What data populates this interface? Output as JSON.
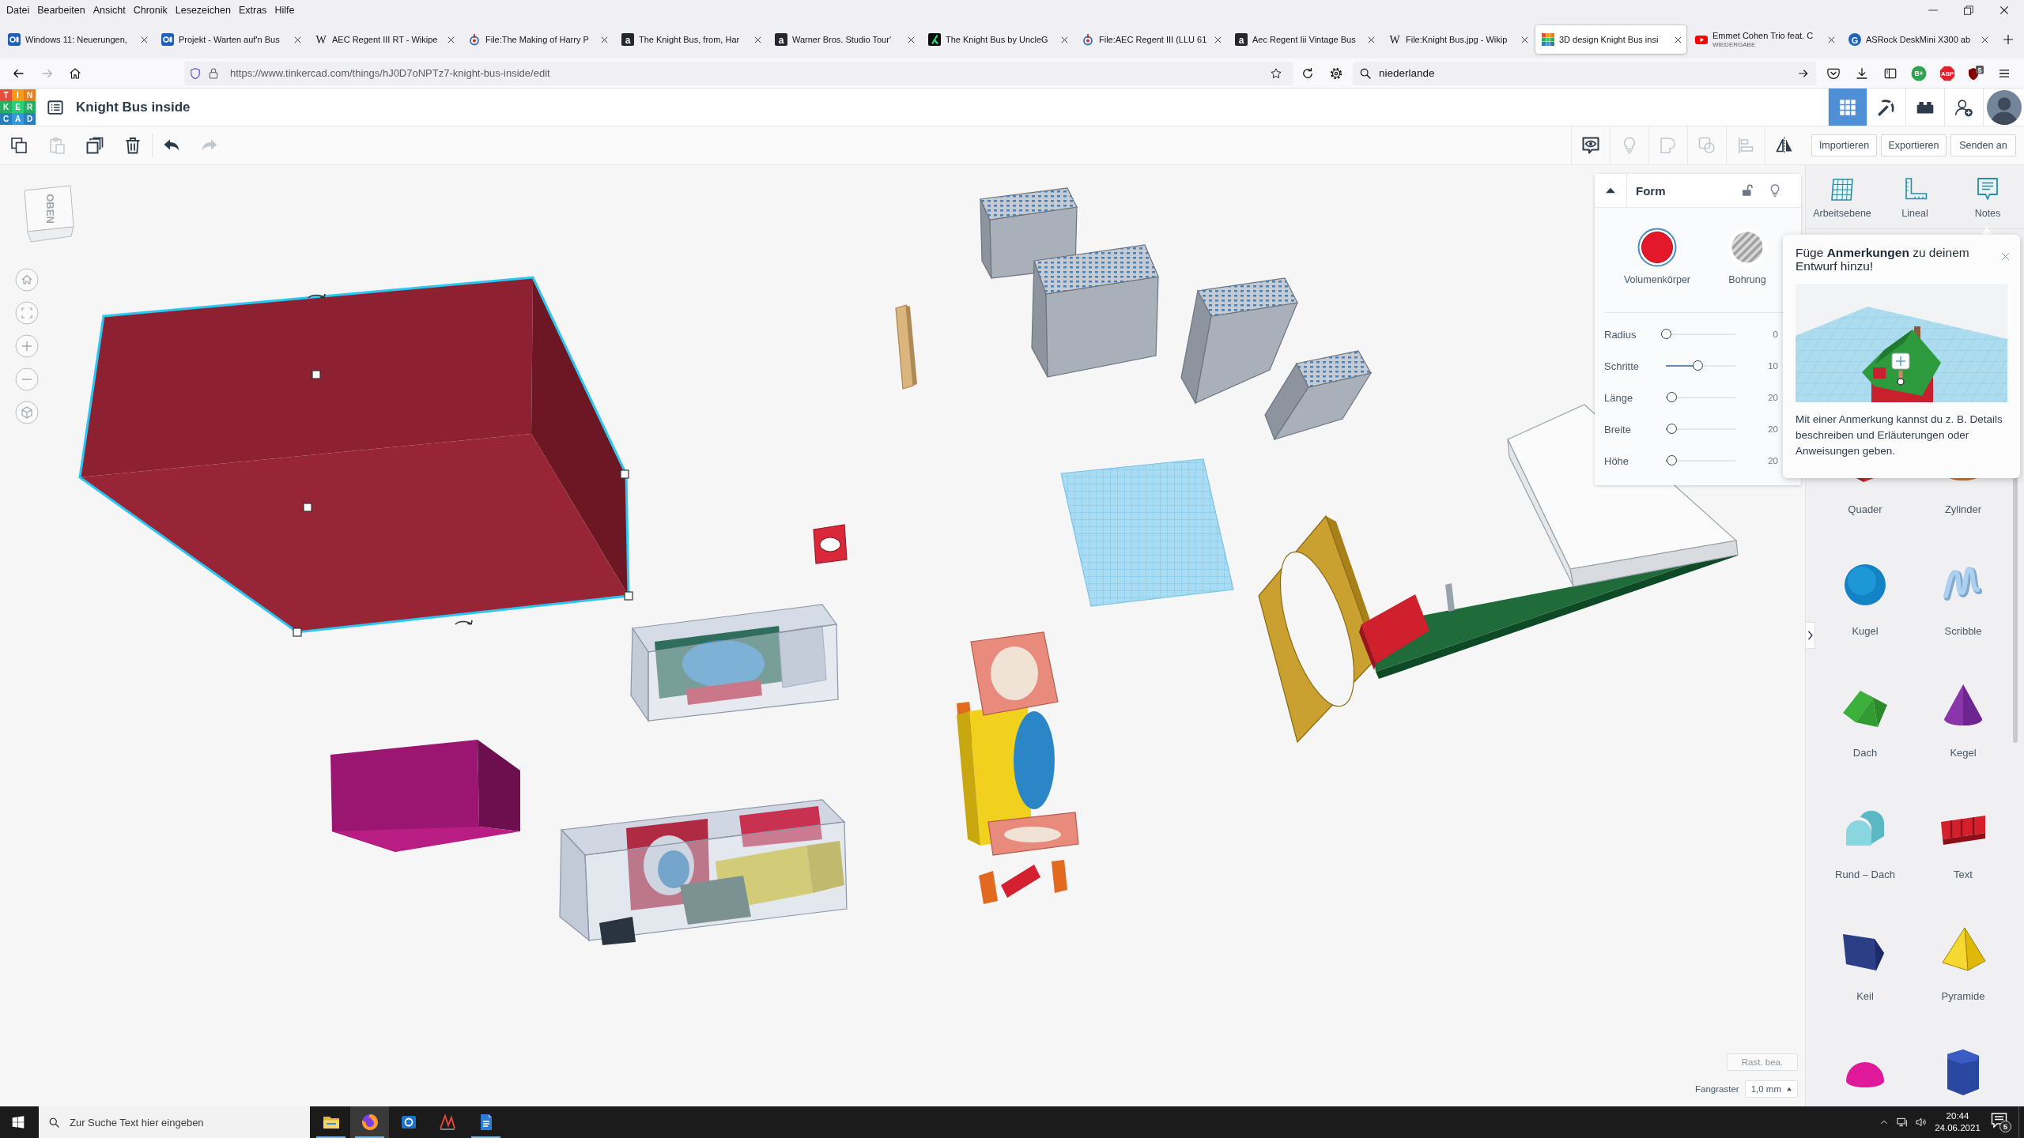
{
  "browser": {
    "menu": [
      "Datei",
      "Bearbeiten",
      "Ansicht",
      "Chronik",
      "Lesezeichen",
      "Extras",
      "Hilfe"
    ],
    "tabs": [
      {
        "title": "Windows 11: Neuerungen,",
        "kind": "cb",
        "selected": false
      },
      {
        "title": "Projekt - Warten auf'n Bus",
        "kind": "cb",
        "selected": false
      },
      {
        "title": "AEC Regent III RT - Wikipe",
        "kind": "wiki",
        "glyph": "W",
        "selected": false
      },
      {
        "title": "File:The Making of Harry P",
        "kind": "commons",
        "selected": false
      },
      {
        "title": "The Knight Bus, from, Har",
        "kind": "a",
        "glyph": "a",
        "selected": false
      },
      {
        "title": "Warner Bros. Studio Tour'",
        "kind": "a",
        "glyph": "a",
        "selected": false
      },
      {
        "title": "The Knight Bus by UncleG",
        "kind": "k",
        "selected": false
      },
      {
        "title": "File:AEC Regent III (LLU 61",
        "kind": "commons",
        "selected": false
      },
      {
        "title": "Aec Regent Iii Vintage Bus",
        "kind": "a",
        "glyph": "a",
        "selected": false
      },
      {
        "title": "File:Knight Bus.jpg - Wikip",
        "kind": "wiki",
        "glyph": "W",
        "selected": false
      },
      {
        "title": "3D design Knight Bus insi",
        "kind": "tinkercad",
        "selected": true
      },
      {
        "title": "Emmet Cohen Trio feat. C",
        "subtitle": "WIEDERGABE",
        "kind": "youtube",
        "selected": false
      },
      {
        "title": "ASRock DeskMini X300 ab",
        "kind": "g",
        "glyph": "G",
        "selected": false
      }
    ],
    "url": "https://www.tinkercad.com/things/hJ0D7oNPTz7-knight-bus-inside/edit",
    "search": {
      "value": "niederlande"
    },
    "extensions": [
      {
        "kind": "bplus",
        "label": "B+"
      },
      {
        "kind": "abp",
        "label": "ABP"
      },
      {
        "kind": "ublock",
        "badge": "5"
      }
    ]
  },
  "app": {
    "logo": [
      [
        "T",
        "I",
        "N"
      ],
      [
        "K",
        "E",
        "R"
      ],
      [
        "C",
        "A",
        "D"
      ]
    ],
    "title": "Knight Bus inside",
    "views": [
      {
        "kind": "grid",
        "selected": true
      },
      {
        "kind": "pickaxe",
        "selected": false
      },
      {
        "kind": "bricks",
        "selected": false
      }
    ],
    "edit_tools": [
      {
        "kind": "copy",
        "disabled": false
      },
      {
        "kind": "paste",
        "disabled": true
      },
      {
        "kind": "duplicate",
        "disabled": false
      },
      {
        "kind": "delete",
        "disabled": false
      }
    ],
    "history_tools": [
      {
        "kind": "undo",
        "disabled": false
      },
      {
        "kind": "redo",
        "disabled": true
      }
    ],
    "shape_tools": [
      {
        "kind": "notes",
        "disabled": false
      },
      {
        "kind": "bulb",
        "disabled": true
      },
      {
        "kind": "group",
        "disabled": true
      },
      {
        "kind": "ungroup",
        "disabled": true
      },
      {
        "kind": "align",
        "disabled": true
      },
      {
        "kind": "mirror",
        "disabled": false
      }
    ],
    "actions": [
      "Importieren",
      "Exportieren",
      "Senden an"
    ]
  },
  "viewcube": {
    "label": "OBEN"
  },
  "view_controls": [
    {
      "kind": "home"
    },
    {
      "kind": "fit"
    },
    {
      "kind": "zoom-in"
    },
    {
      "kind": "zoom-out"
    },
    {
      "kind": "ortho"
    }
  ],
  "scene": {
    "objects": [
      {
        "kind": "box",
        "selected": true
      },
      {
        "kind": "stick",
        "selected": false
      },
      {
        "kind": "stamps",
        "selected": false
      },
      {
        "kind": "plate",
        "selected": false
      },
      {
        "kind": "tile",
        "selected": false
      },
      {
        "kind": "case",
        "selected": false
      },
      {
        "kind": "block",
        "selected": false
      },
      {
        "kind": "crate",
        "selected": false
      },
      {
        "kind": "figure",
        "selected": false
      },
      {
        "kind": "frame",
        "selected": false
      },
      {
        "kind": "deck",
        "selected": false
      },
      {
        "kind": "slab",
        "selected": false
      }
    ]
  },
  "inspector": {
    "title": "Form",
    "options": [
      {
        "label": "Volumenkörper",
        "kind": "solid",
        "selected": true
      },
      {
        "label": "Bohrung",
        "kind": "hole",
        "selected": false
      }
    ],
    "sliders": [
      {
        "label": "Radius",
        "level": 0,
        "value": "0"
      },
      {
        "label": "Schritte",
        "level": 0.46,
        "value": "10"
      },
      {
        "label": "Länge",
        "level": 0.09,
        "value": "20"
      },
      {
        "label": "Breite",
        "level": 0.09,
        "value": "20"
      },
      {
        "label": "Höhe",
        "level": 0.09,
        "value": "20"
      }
    ]
  },
  "tools": [
    {
      "label": "Arbeitsebene",
      "kind": "workplane"
    },
    {
      "label": "Lineal",
      "kind": "ruler"
    },
    {
      "label": "Notes",
      "kind": "notes"
    }
  ],
  "notes_tip": {
    "title": "Füge **Anmerkungen** zu deinem Entwurf hinzu!",
    "body": "Mit einer Anmerkung kannst du z. B. Details beschreiben und Erläuterungen oder Anweisungen geben."
  },
  "shapes": [
    {
      "label": "Quader",
      "kind": "box"
    },
    {
      "label": "Zylinder",
      "kind": "cylinder"
    },
    {
      "label": "Kugel",
      "kind": "sphere"
    },
    {
      "label": "Scribble",
      "kind": "scribble"
    },
    {
      "label": "Dach",
      "kind": "roof"
    },
    {
      "label": "Kegel",
      "kind": "cone"
    },
    {
      "label": "Rund – Dach",
      "kind": "round-roof"
    },
    {
      "label": "Text",
      "kind": "text"
    },
    {
      "label": "Keil",
      "kind": "wedge"
    },
    {
      "label": "Pyramide",
      "kind": "pyramid"
    },
    {
      "kind": "half-sphere"
    },
    {
      "kind": "polygon"
    }
  ],
  "grid_controls": {
    "edit_label": "Rast. bea.",
    "snap_label": "Fangraster",
    "snap_value": "1,0 mm"
  },
  "taskbar": {
    "search": {
      "placeholder": "Zur Suche Text hier eingeben"
    },
    "apps": [
      {
        "kind": "explorer",
        "selected": false,
        "open": true
      },
      {
        "kind": "firefox",
        "selected": true,
        "open": true
      },
      {
        "kind": "mail",
        "selected": false,
        "open": false
      },
      {
        "kind": "tool",
        "selected": false,
        "open": false
      },
      {
        "kind": "document",
        "selected": false,
        "open": true
      }
    ],
    "time": "20:44",
    "date": "24.06.2021",
    "notifications": "5"
  }
}
